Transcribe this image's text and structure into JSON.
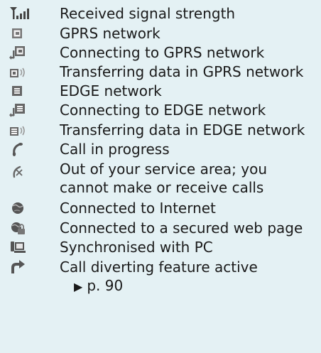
{
  "icon_list": [
    {
      "icon": "signal-strength-icon",
      "text": "Received signal strength"
    },
    {
      "icon": "gprs-network-icon",
      "text": "GPRS network"
    },
    {
      "icon": "gprs-connecting-icon",
      "text": "Connecting to GPRS network"
    },
    {
      "icon": "gprs-transfer-icon",
      "text": "Transferring data in GPRS network"
    },
    {
      "icon": "edge-network-icon",
      "text": "EDGE network"
    },
    {
      "icon": "edge-connecting-icon",
      "text": "Connecting to EDGE network"
    },
    {
      "icon": "edge-transfer-icon",
      "text": "Transferring data in EDGE network"
    },
    {
      "icon": "call-in-progress-icon",
      "text": "Call in progress"
    },
    {
      "icon": "out-of-service-icon",
      "text": "Out of your service area; you",
      "text2": "cannot make or receive calls"
    },
    {
      "icon": "internet-icon",
      "text": "Connected to Internet"
    },
    {
      "icon": "secured-web-icon",
      "text": "Connected to a secured web page"
    },
    {
      "icon": "pc-sync-icon",
      "text": "Synchronised with PC"
    },
    {
      "icon": "call-divert-icon",
      "text": "Call diverting feature active",
      "ref": "p. 90"
    }
  ],
  "colors": {
    "background": "#e4f1f4",
    "icon": "#555555",
    "text": "#1a1a1a"
  }
}
